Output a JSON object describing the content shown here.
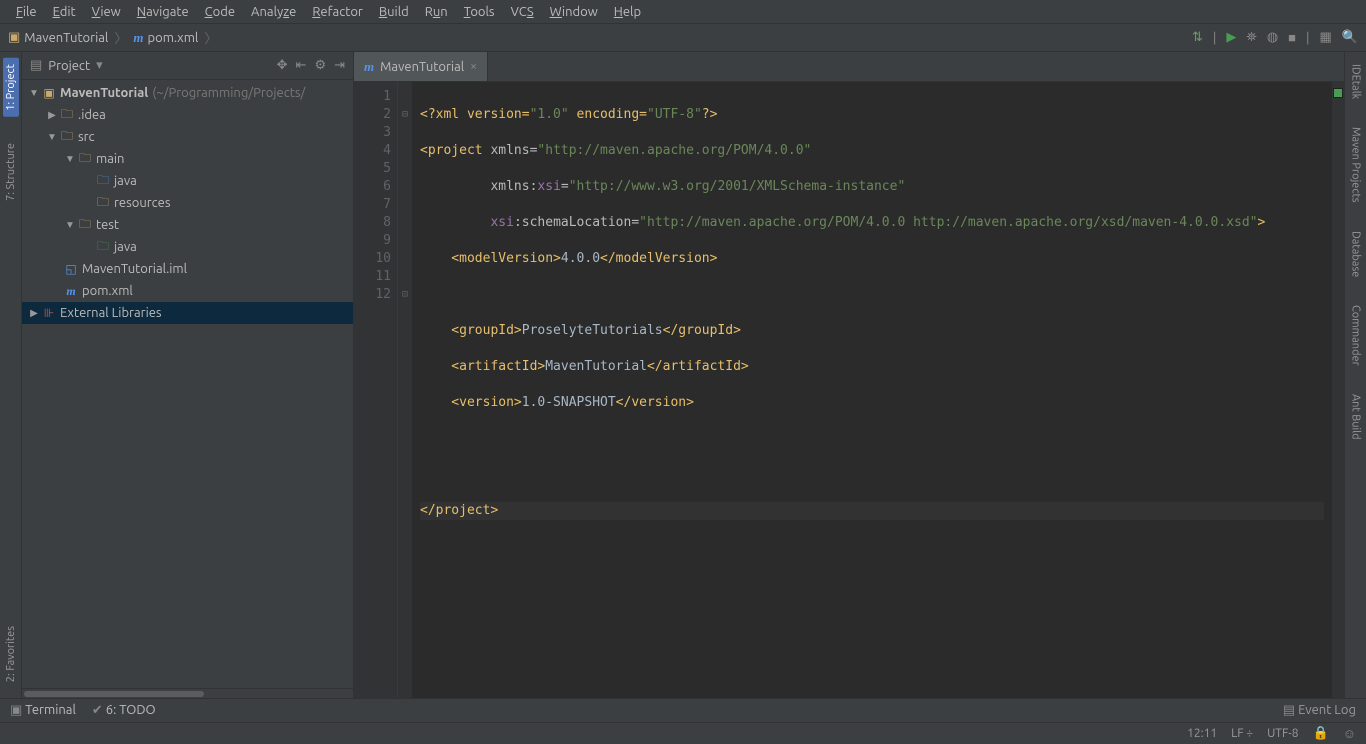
{
  "menu": [
    "File",
    "Edit",
    "View",
    "Navigate",
    "Code",
    "Analyze",
    "Refactor",
    "Build",
    "Run",
    "Tools",
    "VCS",
    "Window",
    "Help"
  ],
  "breadcrumb": {
    "project": "MavenTutorial",
    "file": "pom.xml"
  },
  "project_panel": {
    "title": "Project",
    "tree": {
      "root": {
        "label": "MavenTutorial",
        "hint": "(~/Programming/Projects/"
      },
      "idea": ".idea",
      "src": "src",
      "main": "main",
      "main_java": "java",
      "resources": "resources",
      "test": "test",
      "test_java": "java",
      "iml": "MavenTutorial.iml",
      "pom": "pom.xml",
      "ext": "External Libraries"
    }
  },
  "left_tabs": {
    "project": "1: Project",
    "structure": "7: Structure",
    "favorites": "2: Favorites"
  },
  "right_tabs": {
    "idetalk": "IDEtalk",
    "maven": "Maven Projects",
    "database": "Database",
    "commander": "Commander",
    "ant": "Ant Build"
  },
  "editor": {
    "tab_label": "MavenTutorial",
    "lines": [
      "1",
      "2",
      "3",
      "4",
      "5",
      "6",
      "7",
      "8",
      "9",
      "10",
      "11",
      "12"
    ],
    "code": {
      "l1_a": "<?xml version=",
      "l1_b": "\"1.0\"",
      "l1_c": " encoding=",
      "l1_d": "\"UTF-8\"",
      "l1_e": "?>",
      "l2_a": "<project ",
      "l2_b": "xmlns=",
      "l2_c": "\"http://maven.apache.org/POM/4.0.0\"",
      "l3_a": "         ",
      "l3_b": "xmlns:",
      "l3_c": "xsi",
      "l3_d": "=",
      "l3_e": "\"http://www.w3.org/2001/XMLSchema-instance\"",
      "l4_a": "         ",
      "l4_b": "xsi",
      "l4_c": ":schemaLocation=",
      "l4_d": "\"http://maven.apache.org/POM/4.0.0 http://maven.apache.org/xsd/maven-4.0.0.xsd\"",
      "l4_e": ">",
      "l5_a": "    <modelVersion>",
      "l5_b": "4.0.0",
      "l5_c": "</modelVersion>",
      "l7_a": "    <groupId>",
      "l7_b": "ProselyteTutorials",
      "l7_c": "</groupId>",
      "l8_a": "    <artifactId>",
      "l8_b": "MavenTutorial",
      "l8_c": "</artifactId>",
      "l9_a": "    <version>",
      "l9_b": "1.0-SNAPSHOT",
      "l9_c": "</version>",
      "l12": "</project>"
    }
  },
  "bottom": {
    "terminal": "Terminal",
    "todo": "6: TODO",
    "event_log": "Event Log"
  },
  "status": {
    "pos": "12:11",
    "sep": "LF ÷",
    "enc": "UTF-8"
  }
}
